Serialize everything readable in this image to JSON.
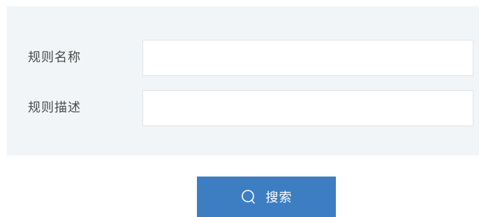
{
  "form": {
    "fields": [
      {
        "label": "规则名称",
        "value": "",
        "placeholder": ""
      },
      {
        "label": "规则描述",
        "value": "",
        "placeholder": ""
      }
    ]
  },
  "actions": {
    "search_label": "搜索",
    "search_icon": "search-icon",
    "button_color": "#3d7ec2"
  },
  "colors": {
    "panel_background": "#f1f5f7",
    "input_border": "#dde3e7",
    "label_text": "#4a4a4a"
  }
}
